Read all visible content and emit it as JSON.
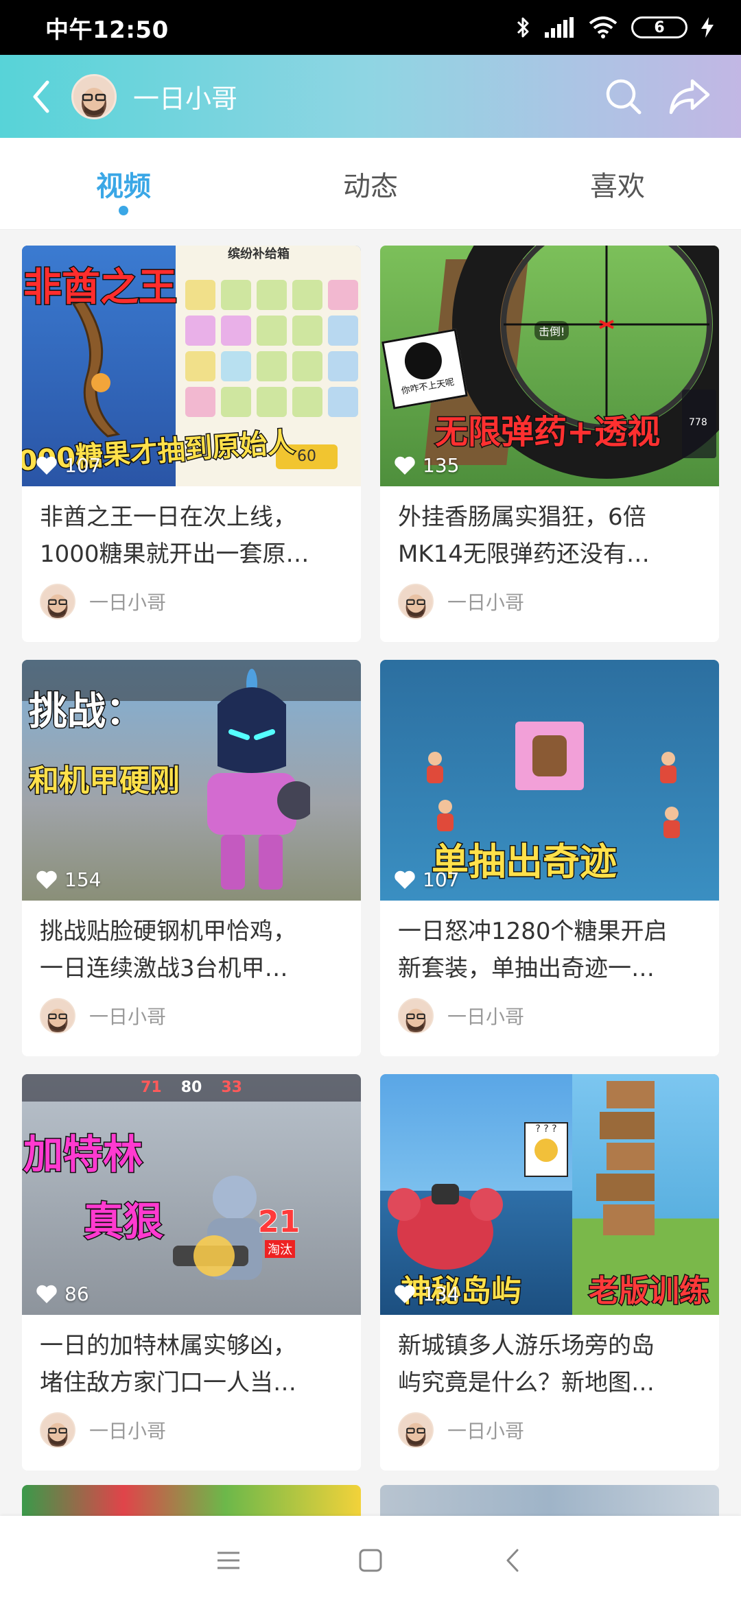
{
  "status": {
    "time": "中午12:50",
    "battery": "6"
  },
  "header": {
    "title": "一日小哥"
  },
  "tabs": [
    {
      "label": "视频",
      "active": true
    },
    {
      "label": "动态",
      "active": false
    },
    {
      "label": "喜欢",
      "active": false
    }
  ],
  "videos": [
    {
      "likes": "107",
      "title_line1": "非酋之王一日在次上线，",
      "title_line2": "1000糖果就开出一套原…",
      "author": "一日小哥",
      "overlay_top": "非酋之王",
      "overlay_bottom": "000糖果才抽到原始人",
      "panel_title": "缤纷补给箱",
      "panel_badge": "60"
    },
    {
      "likes": "135",
      "title_line1": "外挂香肠属实猖狂，6倍",
      "title_line2": "MK14无限弹药还没有…",
      "author": "一日小哥",
      "overlay_bottom": "无限弹药+透视",
      "sticker_text": "你咋不上天呢",
      "kill_text": "击倒!",
      "hud_number": "778"
    },
    {
      "likes": "154",
      "title_line1": "挑战贴脸硬钢机甲恰鸡，",
      "title_line2": "一日连续激战3台机甲…",
      "author": "一日小哥",
      "overlay_top": "挑战：",
      "overlay_mid": "和机甲硬刚"
    },
    {
      "likes": "107",
      "title_line1": "一日怒冲1280个糖果开启",
      "title_line2": "新套装，单抽出奇迹一…",
      "author": "一日小哥",
      "overlay_bottom": "单抽出奇迹"
    },
    {
      "likes": "86",
      "title_line1": "一日的加特林属实够凶，",
      "title_line2": "堵住敌方家门口一人当…",
      "author": "一日小哥",
      "overlay_top": "加特林",
      "overlay_mid": "真狠",
      "score_left": "71",
      "score_mid": "80",
      "score_right": "33",
      "kill_count": "21",
      "kill_label": "淘汰"
    },
    {
      "likes": "134",
      "title_line1": "新城镇多人游乐场旁的岛",
      "title_line2": "屿究竟是什么？新地图…",
      "author": "一日小哥",
      "overlay_left": "神秘岛屿",
      "overlay_right": "老版训练",
      "sticker_text": "? ? ?"
    }
  ]
}
